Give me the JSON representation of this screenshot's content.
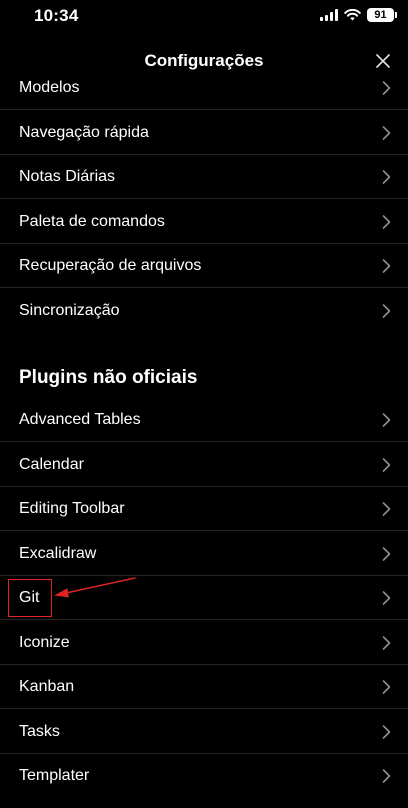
{
  "status_bar": {
    "time": "10:34",
    "battery": "91",
    "icons": [
      "signal-icon",
      "wifi-icon",
      "battery-icon"
    ]
  },
  "header": {
    "title": "Configurações",
    "close_icon": "close-icon"
  },
  "core_items": [
    {
      "label": "Modelos"
    },
    {
      "label": "Navegação rápida"
    },
    {
      "label": "Notas Diárias"
    },
    {
      "label": "Paleta de comandos"
    },
    {
      "label": "Recuperação de arquivos"
    },
    {
      "label": "Sincronização"
    }
  ],
  "plugins_section": {
    "title": "Plugins não oficiais",
    "items": [
      {
        "label": "Advanced Tables"
      },
      {
        "label": "Calendar"
      },
      {
        "label": "Editing Toolbar"
      },
      {
        "label": "Excalidraw"
      },
      {
        "label": "Git"
      },
      {
        "label": "Iconize"
      },
      {
        "label": "Kanban"
      },
      {
        "label": "Tasks"
      },
      {
        "label": "Templater"
      }
    ]
  },
  "colors": {
    "background": "#000000",
    "text": "#ffffff",
    "separator": "#262626",
    "chevron": "#8e8e93",
    "annotation": "#e02424"
  }
}
